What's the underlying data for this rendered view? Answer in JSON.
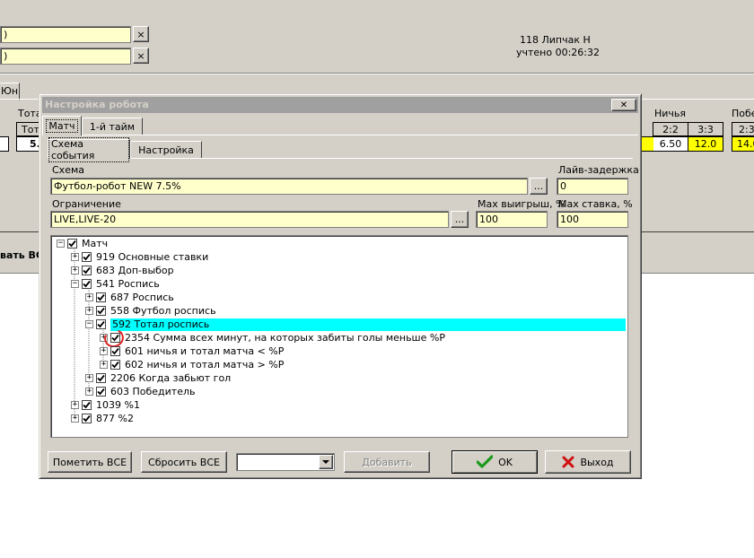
{
  "background": {
    "field1_text": ")",
    "field2_text": ")",
    "clear_glyph": "×",
    "user_line": "118 Липчак Н",
    "time_line": "учтено 00:26:32",
    "tab_partial": "Юн",
    "col_total_hdr": "Тота",
    "col_total_sub": "Тот",
    "col_total_val": "5.",
    "col_draw_hdr": "Ничья",
    "draw_cells": [
      "2:2",
      "3:3"
    ],
    "draw_vals": [
      "6.50",
      "12.0"
    ],
    "col_win_hdr": "Побе",
    "win_cell": "2:3",
    "win_val": "14.0",
    "left_partial": "вать ВС"
  },
  "dialog": {
    "title": "Настройка робота",
    "close_glyph": "✕",
    "tabs_top": [
      "Матч",
      "1-й тайм"
    ],
    "tabs_inner": [
      "Схема события",
      "Настройка"
    ],
    "schema_label": "Схема",
    "schema_value": "Футбол-робот NEW 7.5%",
    "browse": "...",
    "live_delay_label": "Лайв-задержка",
    "live_delay_value": "0",
    "restriction_label": "Ограничение",
    "restriction_value": "LIVE,LIVE-20",
    "max_win_label": "Max выигрыш, %",
    "max_win_value": "100",
    "max_bet_label": "Max ставка, %",
    "max_bet_value": "100",
    "tree": [
      {
        "level": 0,
        "exp": "−",
        "text": "Матч"
      },
      {
        "level": 1,
        "exp": "+",
        "text": "919 Основные ставки"
      },
      {
        "level": 1,
        "exp": "+",
        "text": "683 Доп-выбор"
      },
      {
        "level": 1,
        "exp": "−",
        "text": "541 Роспись"
      },
      {
        "level": 2,
        "exp": "+",
        "text": "687 Роспись"
      },
      {
        "level": 2,
        "exp": "+",
        "text": "558 Футбол роспись"
      },
      {
        "level": 2,
        "exp": "−",
        "text": "592 Тотал роспись",
        "selected": true
      },
      {
        "level": 3,
        "exp": "+",
        "text": "2354 Сумма всех минут, на которых забиты голы меньше %P",
        "circled": true
      },
      {
        "level": 3,
        "exp": "+",
        "text": "601 ничья и тотал матча < %P"
      },
      {
        "level": 3,
        "exp": "+",
        "text": "602 ничья и тотал матча > %P"
      },
      {
        "level": 2,
        "exp": "+",
        "text": "2206 Когда забьют гол"
      },
      {
        "level": 2,
        "exp": "+",
        "text": "603 Победитель"
      },
      {
        "level": 1,
        "exp": "+",
        "text": "1039 %1"
      },
      {
        "level": 1,
        "exp": "+",
        "text": "877 %2"
      }
    ],
    "mark_all": "Пометить ВСЕ",
    "reset_all": "Сбросить ВСЕ",
    "combo_value": "",
    "add": "Добавить",
    "ok": "OK",
    "exit": "Выход"
  },
  "colors": {
    "selection": "#00ffff",
    "field_yellow": "#ffffcc",
    "cell_yellow": "#ffff00",
    "title_gray": "#a0a0a0",
    "annotation_red": "#e02020"
  }
}
